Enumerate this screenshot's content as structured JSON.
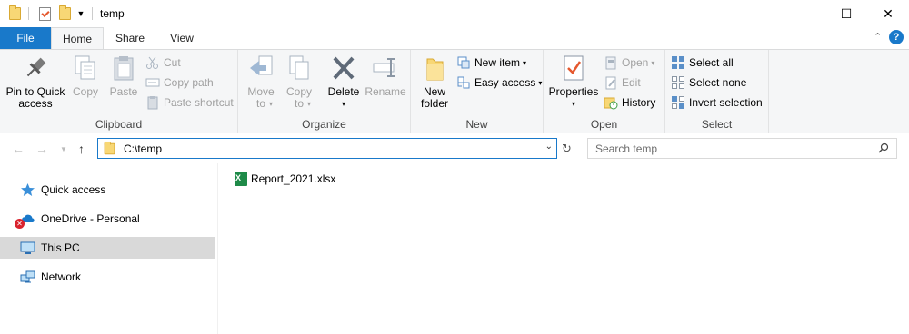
{
  "window": {
    "title": "temp"
  },
  "window_controls": {
    "minimize": "—",
    "maximize": "☐",
    "close": "✕"
  },
  "ribbon_tabs": [
    {
      "label": "File"
    },
    {
      "label": "Home"
    },
    {
      "label": "Share"
    },
    {
      "label": "View"
    }
  ],
  "ribbon": {
    "clipboard": {
      "label": "Clipboard",
      "pin_label_1": "Pin to Quick",
      "pin_label_2": "access",
      "copy": "Copy",
      "paste": "Paste",
      "cut": "Cut",
      "copy_path": "Copy path",
      "paste_shortcut": "Paste shortcut"
    },
    "organize": {
      "label": "Organize",
      "move_to_1": "Move",
      "move_to_2": "to",
      "copy_to_1": "Copy",
      "copy_to_2": "to",
      "delete": "Delete",
      "rename": "Rename"
    },
    "new": {
      "label": "New",
      "new_folder_1": "New",
      "new_folder_2": "folder",
      "new_item": "New item",
      "easy_access": "Easy access"
    },
    "open": {
      "label": "Open",
      "properties": "Properties",
      "open": "Open",
      "edit": "Edit",
      "history": "History"
    },
    "select": {
      "label": "Select",
      "select_all": "Select all",
      "select_none": "Select none",
      "invert_selection": "Invert selection"
    }
  },
  "address": {
    "path": "C:\\temp"
  },
  "search": {
    "placeholder": "Search temp"
  },
  "nav_pane": {
    "items": [
      {
        "label": "Quick access"
      },
      {
        "label": "OneDrive - Personal"
      },
      {
        "label": "This PC"
      },
      {
        "label": "Network"
      }
    ]
  },
  "files": [
    {
      "name": "Report_2021.xlsx"
    }
  ],
  "colors": {
    "accent": "#1979ca",
    "folder": "#f8d775",
    "excel": "#1e8a48",
    "selected": "#d9d9d9"
  }
}
